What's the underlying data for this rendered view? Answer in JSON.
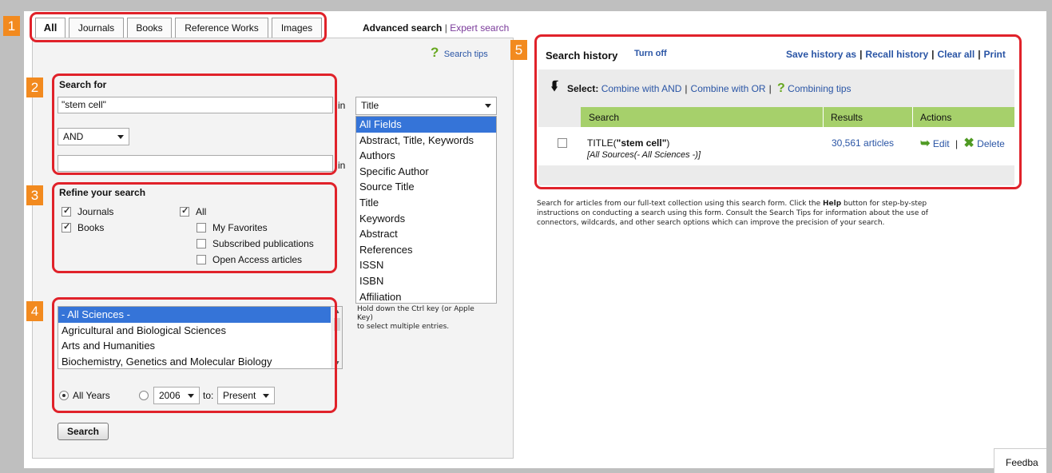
{
  "tabs": [
    "All",
    "Journals",
    "Books",
    "Reference Works",
    "Images"
  ],
  "top_links": {
    "advanced": "Advanced search",
    "separator": "|",
    "expert": "Expert search"
  },
  "search_tips": "Search tips",
  "search_for": {
    "heading": "Search for",
    "term1": "\"stem cell\"",
    "in_label": "in",
    "field_select": "Title",
    "operator": "AND",
    "term2": ""
  },
  "field_options": [
    "All Fields",
    "Abstract, Title, Keywords",
    "Authors",
    "Specific Author",
    "Source Title",
    "Title",
    "Keywords",
    "Abstract",
    "References",
    "ISSN",
    "ISBN",
    "Affiliation"
  ],
  "multi_select_hint": [
    "Hold down the Ctrl key (or Apple",
    "Key)",
    "to select multiple entries."
  ],
  "refine": {
    "heading": "Refine your search",
    "journals": "Journals",
    "books": "Books",
    "all": "All",
    "my_favorites": "My Favorites",
    "subscribed": "Subscribed publications",
    "open_access": "Open Access articles"
  },
  "subject_areas": [
    "- All Sciences -",
    "Agricultural and Biological Sciences",
    "Arts and Humanities",
    "Biochemistry, Genetics and Molecular Biology"
  ],
  "years": {
    "all_years": "All Years",
    "from": "2006",
    "to_label": "to:",
    "to": "Present"
  },
  "search_button": "Search",
  "history": {
    "title": "Search history",
    "turn_off": "Turn off",
    "save_as": "Save history as",
    "recall": "Recall history",
    "clear_all": "Clear all",
    "print": "Print",
    "sep": "|",
    "select_label": "Select:",
    "combine_and": "Combine with AND",
    "combine_or": "Combine with OR",
    "combining_tips": "Combining tips",
    "columns": [
      "Search",
      "Results",
      "Actions"
    ],
    "row": {
      "prefix": "TITLE(",
      "term": "\"stem cell\"",
      "suffix": ")",
      "sources": "[All Sources(- All Sciences -)]",
      "results": "30,561 articles",
      "edit": "Edit",
      "delete": "Delete"
    }
  },
  "help": {
    "line1_a": "Search for articles from our full-text collection using this search form. Click the ",
    "help_word": "Help",
    "line1_b": " button for step-by-step",
    "line2": "instructions on conducting a search using this form. Consult the Search Tips for information about the use of",
    "line3": "connectors, wildcards, and other search options which can improve the precision of your search."
  },
  "feedback": "Feedba",
  "badges": [
    "1",
    "2",
    "3",
    "4",
    "5"
  ],
  "colors": {
    "annotation": "#e0222a",
    "badge": "#f28a1f",
    "link": "#2a55a5",
    "selection": "#3574d8",
    "history_header": "#a6d06b"
  }
}
